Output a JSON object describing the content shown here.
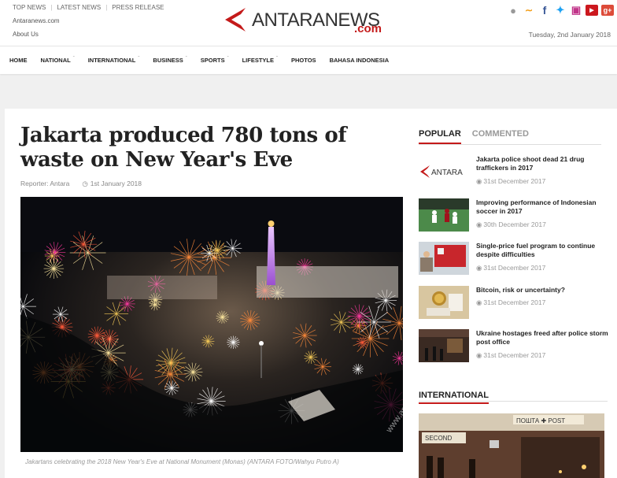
{
  "top_links": [
    "TOP NEWS",
    "LATEST NEWS",
    "PRESS RELEASE"
  ],
  "sub_links": [
    "Antaranews.com",
    "About Us"
  ],
  "logo": {
    "part1": "ANTARANEWS",
    "part2": ".com"
  },
  "social_icons": [
    "user-icon",
    "rss-icon",
    "facebook-icon",
    "twitter-icon",
    "instagram-icon",
    "youtube-icon",
    "google-plus-icon"
  ],
  "date": "Tuesday, 2nd January 2018",
  "nav": [
    {
      "label": "HOME",
      "dropdown": false
    },
    {
      "label": "NATIONAL",
      "dropdown": true
    },
    {
      "label": "INTERNATIONAL",
      "dropdown": true
    },
    {
      "label": "BUSINESS",
      "dropdown": true
    },
    {
      "label": "SPORTS",
      "dropdown": true
    },
    {
      "label": "LIFESTYLE",
      "dropdown": true
    },
    {
      "label": "PHOTOS",
      "dropdown": false
    },
    {
      "label": "BAHASA INDONESIA",
      "dropdown": false
    }
  ],
  "article": {
    "title": "Jakarta produced 780 tons of waste on New Year's Eve",
    "reporter": "Reporter: Antara",
    "date": "1st January 2018",
    "caption": "Jakartans celebrating the 2018 New Year's Eve at National Monument (Monas) (ANTARA FOTO/Wahyu Putro A)",
    "watermark": "www.antaranews.com"
  },
  "tabs": {
    "popular": "POPULAR",
    "commented": "COMMENTED"
  },
  "popular": [
    {
      "title": "Jakarta police shoot dead 21 drug traffickers in 2017",
      "time": "31st December 2017",
      "thumb_text": "ANTARA"
    },
    {
      "title": "Improving performance of Indonesian soccer in 2017",
      "time": "30th December 2017"
    },
    {
      "title": "Single-price fuel program to continue despite difficulties",
      "time": "31st December 2017"
    },
    {
      "title": "Bitcoin, risk or uncertainty?",
      "time": "31st December 2017"
    },
    {
      "title": "Ukraine hostages freed after police storm post office",
      "time": "31st December 2017"
    }
  ],
  "international": {
    "heading": "INTERNATIONAL",
    "image_signs": [
      "ПОШТА ✚ POST",
      "SECOND"
    ]
  },
  "colors": {
    "accent": "#c41a1a",
    "text": "#222222",
    "muted": "#999999"
  }
}
